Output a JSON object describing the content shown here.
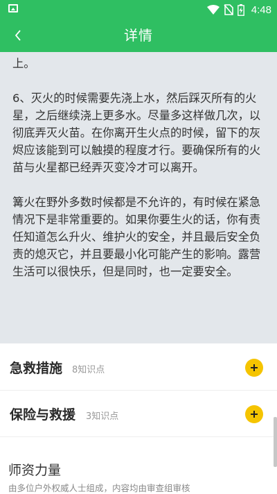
{
  "status_bar": {
    "time": "4:48"
  },
  "app_bar": {
    "title": "详情"
  },
  "article": {
    "paragraphs": [
      "上。",
      "6、灭火的时候需要先浇上水，然后踩灭所有的火星，之后继续浇上更多水。尽量多这样做几次，以彻底弄灭火苗。在你离开生火点的时候，留下的灰烬应该能到可以触摸的程度才行。要确保所有的火苗与火星都已经弄灭变冷才可以离开。",
      "篝火在野外多数时候都是不允许的，有时候在紧急情况下是非常重要的。如果你要生火的话，你有责任知道怎么升火、维护火的安全，并且最后安全负责的熄灭它，并且要最小化可能产生的影响。露营生活可以很快乐，但是同时，也一定要安全。"
    ]
  },
  "sections": [
    {
      "title": "急救措施",
      "count": "8知识点"
    },
    {
      "title": "保险与救援",
      "count": "3知识点"
    }
  ],
  "teachers": {
    "title": "师资力量",
    "desc": "由多位户外权威人士组成，内容均由审查组审核"
  },
  "colors": {
    "primary": "#2fbf62",
    "accent": "#f5c400",
    "article_bg": "#e3e7eb"
  }
}
